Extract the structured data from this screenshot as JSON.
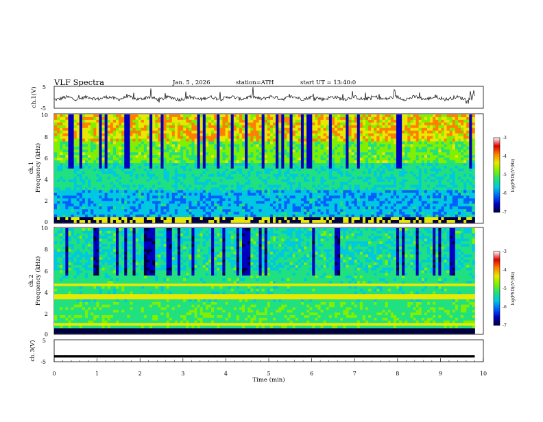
{
  "header": {
    "title": "VLF Spectra",
    "date": "Jan. 5 , 2026",
    "station": "station=ATH",
    "start": "start UT =  13:40:0"
  },
  "colors": {
    "colormap": [
      "#000040",
      "#0000c0",
      "#0060ff",
      "#00c8e0",
      "#20e080",
      "#80f000",
      "#e8e800",
      "#ff8000",
      "#e00000",
      "#ffffff"
    ],
    "trace": "#000000"
  },
  "chart_data": [
    {
      "type": "line",
      "title": "",
      "ylabel": "ch.1(V)",
      "ylim": [
        -5,
        5
      ],
      "yticks": [
        "5",
        "-5"
      ],
      "x": [
        0,
        1,
        2,
        3,
        4,
        5,
        6,
        7,
        8,
        9,
        9.8
      ],
      "series": [
        {
          "values": [
            -0.5,
            -0.3,
            -0.4,
            -0.5,
            -0.3,
            -0.2,
            -0.3,
            -0.4,
            -0.3,
            -0.4,
            -0.4
          ]
        }
      ]
    },
    {
      "type": "heatmap",
      "title": "",
      "ylabel_line1": "ch.1",
      "ylabel_line2": "Frequency (kHz)",
      "xlim": [
        0,
        10
      ],
      "ylim": [
        0,
        10
      ],
      "yticks": [
        "0",
        "2",
        "4",
        "6",
        "8",
        "10"
      ],
      "colorbar_label": "log(PSD)(V²/Hz)",
      "colorbar_ticks": [
        "-3",
        "-4",
        "-5",
        "-6",
        "-7"
      ],
      "colorbar_range": [
        -7,
        -3
      ]
    },
    {
      "type": "heatmap",
      "title": "",
      "ylabel_line1": "ch.2",
      "ylabel_line2": "Frequency (kHz)",
      "xlim": [
        0,
        10
      ],
      "ylim": [
        0,
        10
      ],
      "yticks": [
        "0",
        "2",
        "4",
        "6",
        "8",
        "10"
      ],
      "colorbar_label": "log(PSD)(V²/Hz)",
      "colorbar_ticks": [
        "-3",
        "-4",
        "-5",
        "-6",
        "-7"
      ],
      "colorbar_range": [
        -7,
        -3
      ]
    },
    {
      "type": "line",
      "title": "",
      "ylabel": "ch.3(V)",
      "ylim": [
        -5,
        5
      ],
      "yticks": [
        "5",
        "-5"
      ],
      "xlabel": "Time (min)",
      "xlim": [
        0,
        10
      ],
      "xticks": [
        "0",
        "1",
        "2",
        "3",
        "4",
        "5",
        "6",
        "7",
        "8",
        "9",
        "10"
      ],
      "x": [
        0,
        9.8
      ],
      "series": [
        {
          "values": [
            -2.5,
            -2.5
          ]
        }
      ]
    }
  ]
}
